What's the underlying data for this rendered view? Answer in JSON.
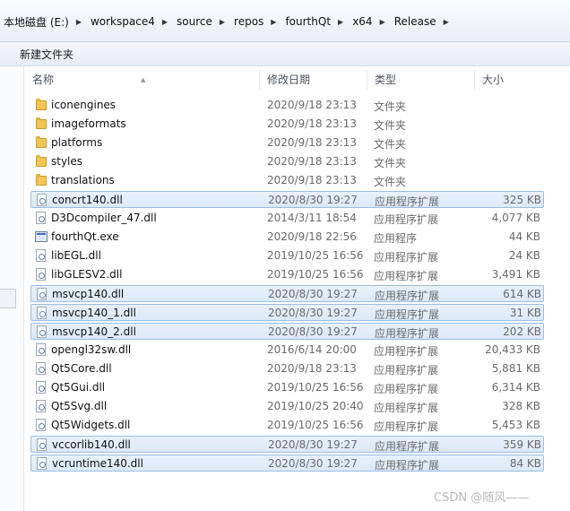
{
  "address": {
    "crumbs": [
      "本地磁盘 (E:)",
      "workspace4",
      "source",
      "repos",
      "fourthQt",
      "x64",
      "Release"
    ],
    "separator": "▶"
  },
  "commandbar": {
    "new_folder": "新建文件夹"
  },
  "columns": {
    "name": "名称",
    "date": "修改日期",
    "type": "类型",
    "size": "大小"
  },
  "files": [
    {
      "name": "iconengines",
      "date": "2020/9/18 23:13",
      "type": "文件夹",
      "size": "",
      "icon": "folder-icon",
      "selected": false
    },
    {
      "name": "imageformats",
      "date": "2020/9/18 23:13",
      "type": "文件夹",
      "size": "",
      "icon": "folder-icon",
      "selected": false
    },
    {
      "name": "platforms",
      "date": "2020/9/18 23:13",
      "type": "文件夹",
      "size": "",
      "icon": "folder-icon",
      "selected": false
    },
    {
      "name": "styles",
      "date": "2020/9/18 23:13",
      "type": "文件夹",
      "size": "",
      "icon": "folder-icon",
      "selected": false
    },
    {
      "name": "translations",
      "date": "2020/9/18 23:13",
      "type": "文件夹",
      "size": "",
      "icon": "folder-icon",
      "selected": false
    },
    {
      "name": "concrt140.dll",
      "date": "2020/8/30 19:27",
      "type": "应用程序扩展",
      "size": "325 KB",
      "icon": "dll-icon",
      "selected": true
    },
    {
      "name": "D3Dcompiler_47.dll",
      "date": "2014/3/11 18:54",
      "type": "应用程序扩展",
      "size": "4,077 KB",
      "icon": "dll-icon",
      "selected": false
    },
    {
      "name": "fourthQt.exe",
      "date": "2020/9/18 22:56",
      "type": "应用程序",
      "size": "44 KB",
      "icon": "exe-icon",
      "selected": false
    },
    {
      "name": "libEGL.dll",
      "date": "2019/10/25 16:56",
      "type": "应用程序扩展",
      "size": "24 KB",
      "icon": "dll-icon",
      "selected": false
    },
    {
      "name": "libGLESV2.dll",
      "date": "2019/10/25 16:56",
      "type": "应用程序扩展",
      "size": "3,491 KB",
      "icon": "dll-icon",
      "selected": false
    },
    {
      "name": "msvcp140.dll",
      "date": "2020/8/30 19:27",
      "type": "应用程序扩展",
      "size": "614 KB",
      "icon": "dll-icon",
      "selected": true
    },
    {
      "name": "msvcp140_1.dll",
      "date": "2020/8/30 19:27",
      "type": "应用程序扩展",
      "size": "31 KB",
      "icon": "dll-icon",
      "selected": true
    },
    {
      "name": "msvcp140_2.dll",
      "date": "2020/8/30 19:27",
      "type": "应用程序扩展",
      "size": "202 KB",
      "icon": "dll-icon",
      "selected": true
    },
    {
      "name": "opengl32sw.dll",
      "date": "2016/6/14 20:00",
      "type": "应用程序扩展",
      "size": "20,433 KB",
      "icon": "dll-icon",
      "selected": false
    },
    {
      "name": "Qt5Core.dll",
      "date": "2020/9/18 23:13",
      "type": "应用程序扩展",
      "size": "5,881 KB",
      "icon": "dll-icon",
      "selected": false
    },
    {
      "name": "Qt5Gui.dll",
      "date": "2019/10/25 16:56",
      "type": "应用程序扩展",
      "size": "6,314 KB",
      "icon": "dll-icon",
      "selected": false
    },
    {
      "name": "Qt5Svg.dll",
      "date": "2019/10/25 20:40",
      "type": "应用程序扩展",
      "size": "328 KB",
      "icon": "dll-icon",
      "selected": false
    },
    {
      "name": "Qt5Widgets.dll",
      "date": "2019/10/25 16:56",
      "type": "应用程序扩展",
      "size": "5,453 KB",
      "icon": "dll-icon",
      "selected": false
    },
    {
      "name": "vccorlib140.dll",
      "date": "2020/8/30 19:27",
      "type": "应用程序扩展",
      "size": "359 KB",
      "icon": "dll-icon",
      "selected": true
    },
    {
      "name": "vcruntime140.dll",
      "date": "2020/8/30 19:27",
      "type": "应用程序扩展",
      "size": "84 KB",
      "icon": "dll-icon",
      "selected": true
    }
  ],
  "watermark": "CSDN @随风——"
}
